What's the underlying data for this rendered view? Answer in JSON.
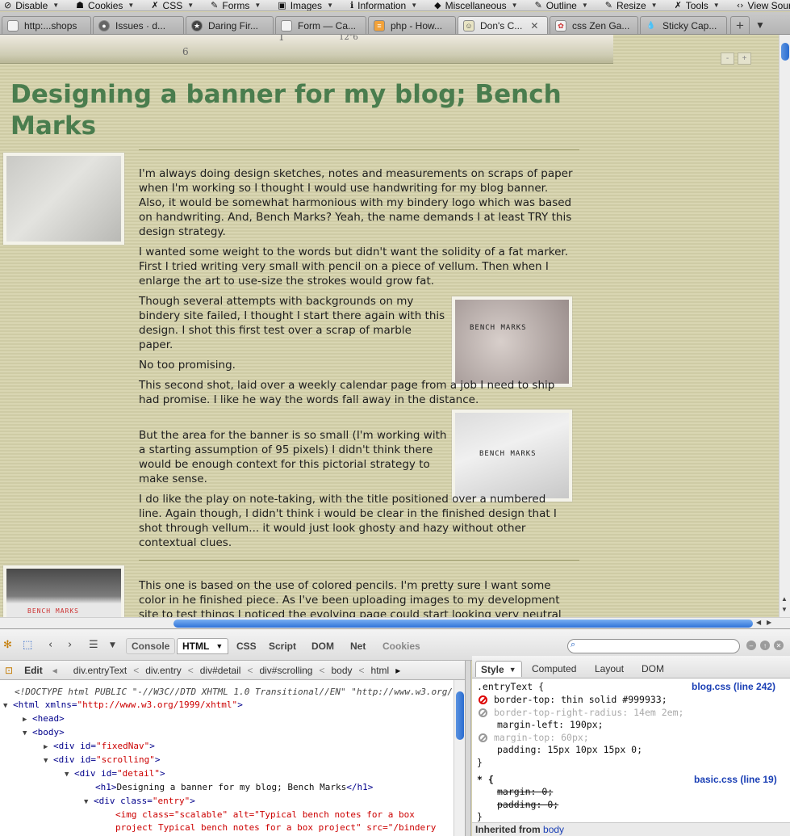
{
  "devbar": {
    "items": [
      {
        "label": "Disable",
        "icon": "ban-icon"
      },
      {
        "label": "Cookies",
        "icon": "person-icon"
      },
      {
        "label": "CSS",
        "icon": "wrench-icon"
      },
      {
        "label": "Forms",
        "icon": "pencil-icon"
      },
      {
        "label": "Images",
        "icon": "image-icon"
      },
      {
        "label": "Information",
        "icon": "info-icon"
      },
      {
        "label": "Miscellaneous",
        "icon": "box-icon"
      },
      {
        "label": "Outline",
        "icon": "pencil-icon"
      },
      {
        "label": "Resize",
        "icon": "pencil-icon"
      },
      {
        "label": "Tools",
        "icon": "wrench-icon"
      },
      {
        "label": "View Source",
        "icon": "code-icon"
      }
    ]
  },
  "tabs": [
    {
      "label": "http:...shops",
      "fav": "page-icon"
    },
    {
      "label": "Issues · d...",
      "fav": "github-icon"
    },
    {
      "label": "Daring Fir...",
      "fav": "star-icon"
    },
    {
      "label": "Form — Ca...",
      "fav": "page-icon"
    },
    {
      "label": "php - How...",
      "fav": "stack-icon"
    },
    {
      "label": "Don's C...",
      "fav": "bench-icon"
    },
    {
      "label": "css Zen Ga...",
      "fav": "flower-icon"
    },
    {
      "label": "Sticky Cap...",
      "fav": "drop-icon"
    }
  ],
  "page": {
    "banner_scribbles": [
      "1",
      "12\"6"
    ],
    "title": "Designing a banner for my blog; Bench Marks",
    "paragraphs": [
      "I'm always doing design sketches, notes and measurements on scraps of paper when I'm working so I thought I would use handwriting for my blog banner. Also, it would be somewhat harmonious with my bindery logo which was based on handwriting. And, Bench Marks? Yeah, the name demands I at least TRY this design strategy.",
      "I wanted some weight to the words but didn't want the solidity of a fat marker. First I tried writing very small with pencil on a piece of vellum. Then when I enlarge the art to use-size the strokes would grow fat.",
      "Though several attempts with backgrounds on my bindery site failed, I thought I start there again with this design. I shot this first test over a scrap of marble paper.",
      "No too promising.",
      "This second shot, laid over a weekly calendar page from a job I need to ship had promise. I like he way the words fall away in the distance.",
      "But the area for the banner is so small (I'm working with a starting assumption of 95 pixels) I didn't think there would be enough context for this pictorial strategy to make sense.",
      "I do like the play on note-taking, with the title positioned over a numbered line. Again though, I didn't think i would be clear in the finished design that I shot through vellum... it would just look ghosty and hazy without other contextual clues.",
      "This one is based on the use of colored pencils. I'm pretty sure I want some color in he finished piece. As I've been uploading images to my development site to test things I noticed the evolving page could start looking very neutral"
    ],
    "photo_caption_2": "BENCH MARKS",
    "photo_caption_3": "BENCH MARKS",
    "photo_caption_4": "BENCH MARKS",
    "page_controls": [
      "-",
      "+"
    ]
  },
  "firebug": {
    "panels": [
      "Console",
      "HTML",
      "CSS",
      "Script",
      "DOM",
      "Net",
      "Cookies"
    ],
    "active_panel": "HTML",
    "edit_label": "Edit",
    "breadcrumbs": [
      "div.entryText",
      "div.entry",
      "div#detail",
      "div#scrolling",
      "body",
      "html"
    ],
    "html_lines": {
      "l1": "<!DOCTYPE html PUBLIC \"-//W3C//DTD XHTML 1.0 Transitional//EN\" \"http://www.w3.org/",
      "l2_tag": "<html ",
      "l2_attr": "xmlns=",
      "l2_val": "\"http://www.w3.org/1999/xhtml\"",
      "l2_end": ">",
      "l3": "<head>",
      "l4": "<body>",
      "l5_tag": "<div ",
      "l5_attr": "id=",
      "l5_val": "\"fixedNav\"",
      "l6_val": "\"scrolling\"",
      "l7_val": "\"detail\"",
      "l8_text": "Designing a banner for my blog; Bench Marks",
      "l9_attr": "class=",
      "l9_val": "\"entry\"",
      "l10": "<img class=\"scalable\" alt=\"Typical bench notes for a box",
      "l11": "project Typical bench notes for a box project\" src=\"/bindery"
    },
    "side_tabs": [
      "Style",
      "Computed",
      "Layout",
      "DOM"
    ],
    "active_side_tab": "Style",
    "rules": [
      {
        "selector": ".entryText {",
        "source": "blog.css (line 242)",
        "props": [
          {
            "name": "border-top",
            "value": "thin solid #999933;",
            "state": "error"
          },
          {
            "name": "border-top-right-radius",
            "value": "14em 2em;",
            "state": "disabled"
          },
          {
            "name": "margin-left",
            "value": "190px;",
            "state": "normal"
          },
          {
            "name": "margin-top",
            "value": "60px;",
            "state": "disabled"
          },
          {
            "name": "padding",
            "value": "15px 10px 15px 0;",
            "state": "normal"
          }
        ]
      },
      {
        "selector": "* {",
        "source": "basic.css (line 19)",
        "props": [
          {
            "name": "margin",
            "value": "0;",
            "state": "overridden"
          },
          {
            "name": "padding",
            "value": "0;",
            "state": "overridden"
          }
        ]
      }
    ],
    "inherited_label": "Inherited from",
    "inherited_link": "body"
  }
}
